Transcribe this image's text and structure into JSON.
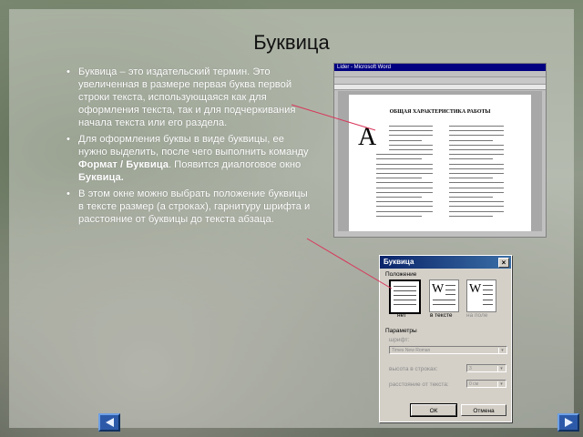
{
  "slide": {
    "title": "Буквица",
    "bullets": [
      {
        "text": "Буквица – это издательский термин. Это увеличенная в размере первая буква первой строки текста, использующаяся как для оформления текста, так и для подчеркивания начала текста или его раздела."
      },
      {
        "pre": "Для оформления буквы в виде буквицы, ее нужно выделить, после чего выполнить команду ",
        "bold1": "Формат / Буквица",
        "mid": ". Появится диалоговое окно ",
        "bold2": "Буквица."
      },
      {
        "text": "В этом окне можно выбрать положение буквицы в тексте размер (а строках), гарнитуру шрифта и расстояние от буквицы до текста абзаца."
      }
    ]
  },
  "word_window": {
    "title": "Lider - Microsoft Word",
    "heading": "ОБЩАЯ ХАРАКТЕРИСТИКА РАБОТЫ",
    "drop_letter": "А"
  },
  "dialog": {
    "title": "Буквица",
    "close_glyph": "×",
    "position_label": "Положение",
    "options": [
      {
        "label": "нет",
        "letter": ""
      },
      {
        "label": "в тексте",
        "letter": "W"
      },
      {
        "label": "на поле",
        "letter": "W"
      }
    ],
    "params_label": "Параметры",
    "font_label": "шрифт:",
    "font_value": "Times New Roman",
    "height_label": "высота в строках:",
    "height_value": "3",
    "distance_label": "расстояние от текста:",
    "distance_value": "0 см",
    "ok": "ОК",
    "cancel": "Отмена"
  },
  "nav": {
    "back_icon": "arrow-left-icon",
    "forward_icon": "arrow-right-icon"
  },
  "colors": {
    "nav_button": "#2d5aa8",
    "pointer_line": "#d9365a"
  }
}
